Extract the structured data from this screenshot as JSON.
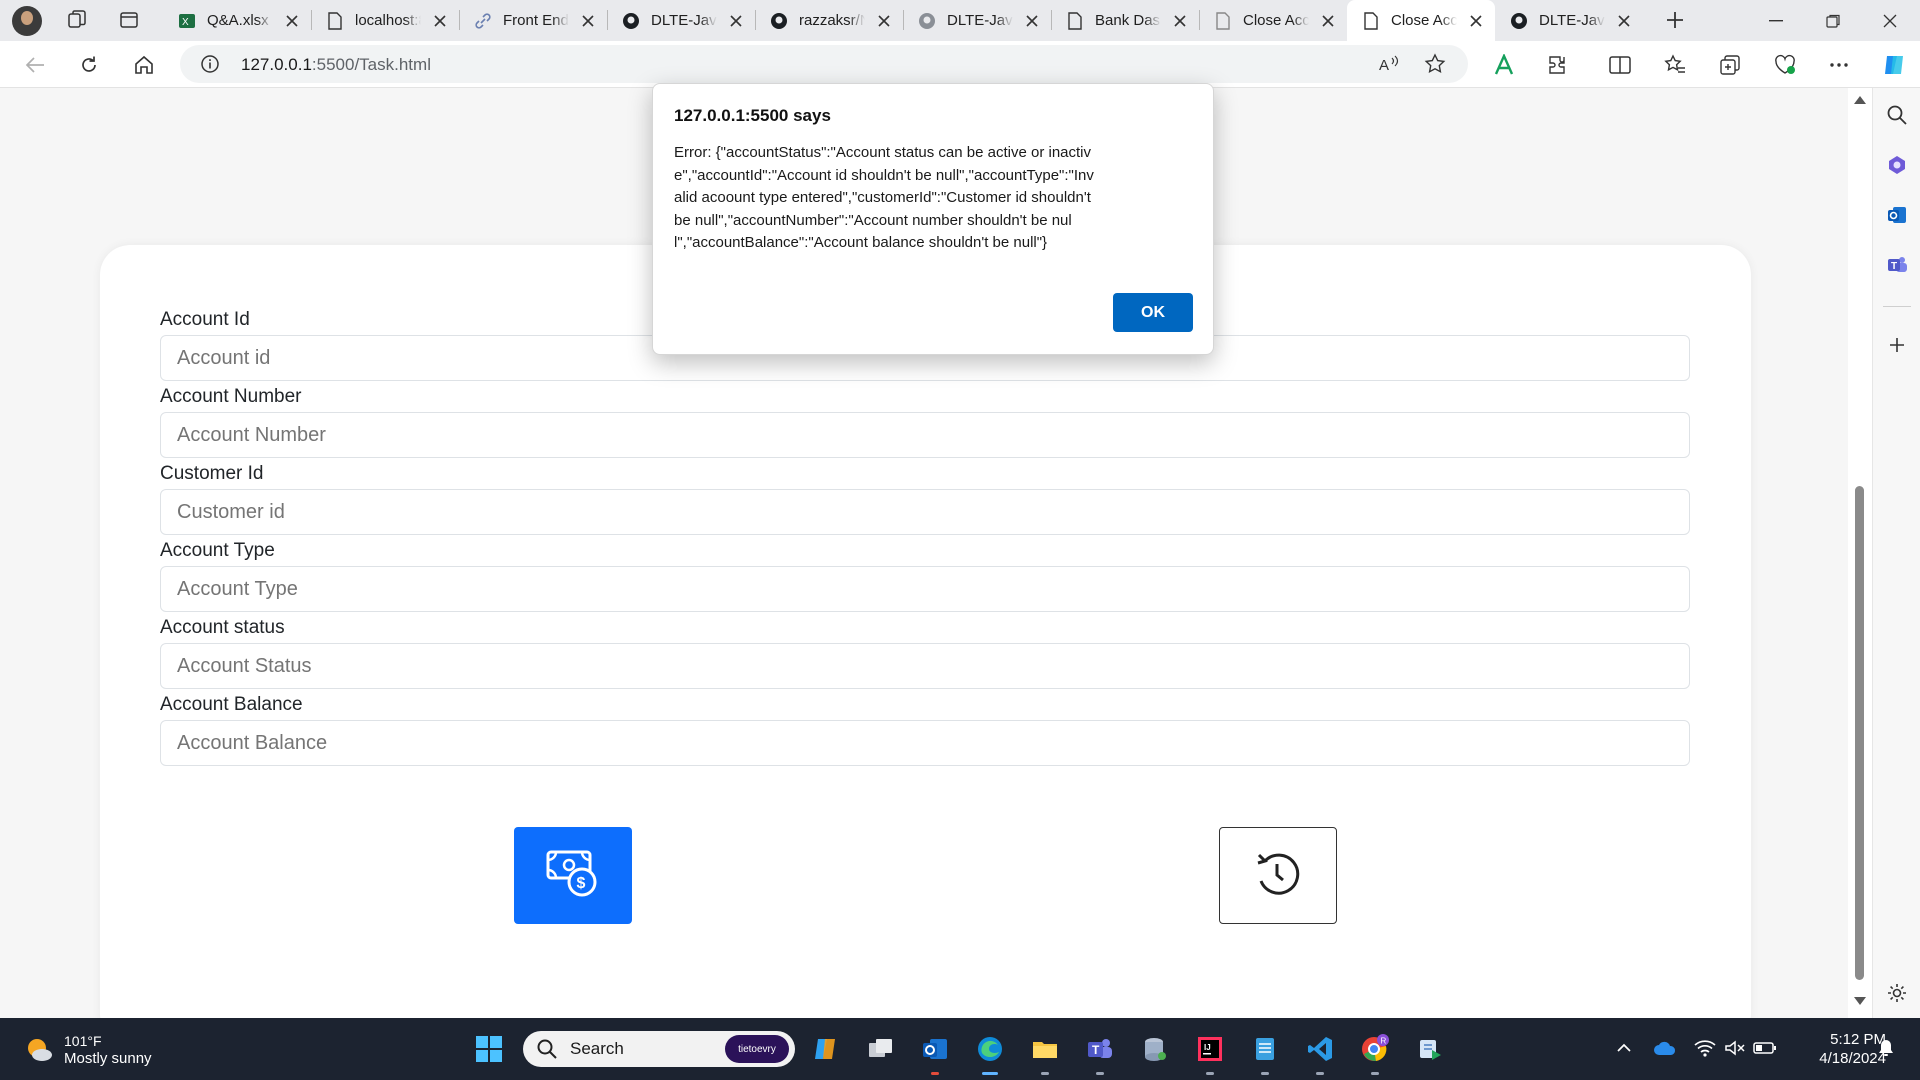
{
  "browser": {
    "tabs": [
      {
        "label": "Q&A.xlsx",
        "icon": "excel-icon"
      },
      {
        "label": "localhost:8",
        "icon": "page-icon"
      },
      {
        "label": "Front End",
        "icon": "link-icon"
      },
      {
        "label": "DLTE-Java",
        "icon": "github-icon"
      },
      {
        "label": "razzaksr/N",
        "icon": "github-icon"
      },
      {
        "label": "DLTE-Java",
        "icon": "github-icon"
      },
      {
        "label": "Bank Dash",
        "icon": "page-icon"
      },
      {
        "label": "Close Acc",
        "icon": "page-icon"
      },
      {
        "label": "Close Acc",
        "icon": "page-icon",
        "active": true
      },
      {
        "label": "DLTE-Java",
        "icon": "github-icon"
      }
    ],
    "url_host": "127.0.0.1",
    "url_rest": ":5500/Task.html"
  },
  "form": {
    "fields": [
      {
        "label": "Account Id",
        "placeholder": "Account id"
      },
      {
        "label": "Account Number",
        "placeholder": "Account Number"
      },
      {
        "label": "Customer Id",
        "placeholder": "Customer id"
      },
      {
        "label": "Account Type",
        "placeholder": "Account Type"
      },
      {
        "label": "Account status",
        "placeholder": "Account Status"
      },
      {
        "label": "Account Balance",
        "placeholder": "Account Balance"
      }
    ],
    "primary_color": "#0d6efd"
  },
  "dialog": {
    "title": "127.0.0.1:5500 says",
    "message": "Error: {\"accountStatus\":\"Account status can be active or inactive\",\"accountId\":\"Account id shouldn't be null\",\"accountType\":\"Invalid acoount type entered\",\"customerId\":\"Customer id shouldn't be null\",\"accountNumber\":\"Account number shouldn't be null\",\"accountBalance\":\"Account balance shouldn't be null\"}",
    "ok_label": "OK"
  },
  "taskbar": {
    "weather_temp": "101°F",
    "weather_desc": "Mostly sunny",
    "search_placeholder": "Search",
    "search_badge": "tietoevry",
    "time": "5:12 PM",
    "date": "4/18/2024"
  }
}
